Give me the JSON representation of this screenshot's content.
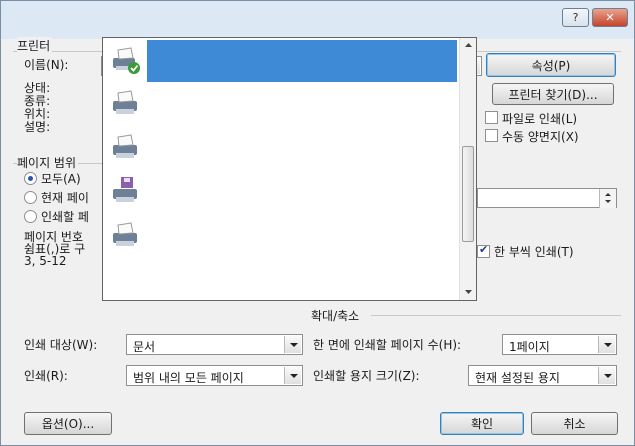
{
  "titlebar": {
    "help": "?",
    "close": "✕"
  },
  "printer": {
    "group_title": "프린터",
    "name_label": "이름(N):",
    "status_label": "상태:",
    "type_label": "종류:",
    "where_label": "위치:",
    "comment_label": "설명:",
    "properties_button": "속성(P)",
    "find_printer_button": "프린터 찾기(D)...",
    "print_to_file": "파일로 인쇄(L)",
    "manual_duplex": "수동 양면지(X)"
  },
  "page_range": {
    "group_title": "페이지 범위",
    "all": "모두(A)",
    "current_page": "현재 페이",
    "selection": "인쇄할 페",
    "help_line1": "페이지 번호",
    "help_line2": "쉼표(,)로 구",
    "help_line3": "3, 5-12"
  },
  "copies": {
    "collate": "한 부씩 인쇄(T)"
  },
  "zoom": {
    "group_title": "확대/축소",
    "pages_per_sheet_label": "한 면에 인쇄할 페이지 수(H):",
    "pages_per_sheet_value": "1페이지",
    "paper_size_label": "인쇄할 용지 크기(Z):",
    "paper_size_value": "현재 설정된 용지"
  },
  "print_what": {
    "label": "인쇄 대상(W):",
    "value": "문서"
  },
  "print": {
    "label": "인쇄(R):",
    "value": "범위 내의 모든 페이지"
  },
  "footer": {
    "options_button": "옵션(O)...",
    "ok_button": "확인",
    "cancel_button": "취소"
  },
  "dropdown": {
    "items": [
      {
        "icon": "printer-default-icon",
        "selected": true
      },
      {
        "icon": "printer-icon",
        "selected": false
      },
      {
        "icon": "printer-icon",
        "selected": false
      },
      {
        "icon": "fax-printer-icon",
        "selected": false
      },
      {
        "icon": "printer-icon",
        "selected": false
      }
    ]
  },
  "colors": {
    "selection": "#3e8ad6",
    "accent": "#3c7fb1"
  }
}
